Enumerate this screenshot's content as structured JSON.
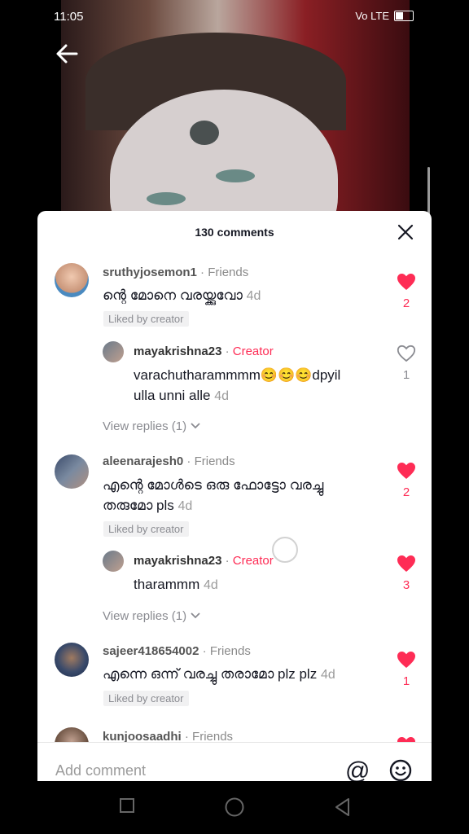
{
  "status_bar": {
    "time": "11:05",
    "network": "4G",
    "volte": "Vo LTE"
  },
  "sheet": {
    "title": "130 comments"
  },
  "comments": [
    {
      "username": "sruthyjosemon1",
      "tag": "Friends",
      "text": "ന്റെ മോനെ വരയ്ക്കുവോ",
      "time": "4d",
      "liked_by": "Liked by creator",
      "likes": "2"
    },
    {
      "username": "mayakrishna23",
      "tag": "Creator",
      "text_line1": "varachutharammmm😊😊😊dpyil",
      "text_line2": "ulla unni alle",
      "time": "4d",
      "likes": "1"
    },
    {
      "view_replies": "View replies (1)"
    },
    {
      "username": "aleenarajesh0",
      "tag": "Friends",
      "text_line1": "എന്റെ മോൾടെ ഒരു ഫോട്ടോ വരച്ചു",
      "text_line2": "തരുമോ pls",
      "time": "4d",
      "liked_by": "Liked by creator",
      "likes": "2"
    },
    {
      "username": "mayakrishna23",
      "tag": "Creator",
      "text": "tharammm",
      "time": "4d",
      "likes": "3"
    },
    {
      "view_replies": "View replies (1)"
    },
    {
      "username": "sajeer418654002",
      "tag": "Friends",
      "text": "എന്നെ ഒന്ന് വരച്ചു തരാമോ plz plz",
      "time": "4d",
      "liked_by": "Liked by creator",
      "likes": "1"
    },
    {
      "username": "kunjoosaadhi",
      "tag": "Friends"
    }
  ],
  "footer": {
    "placeholder": "Add comment",
    "at_symbol": "@"
  },
  "colors": {
    "accent": "#fe2c55",
    "text": "#161823",
    "muted": "#8a8b91"
  }
}
